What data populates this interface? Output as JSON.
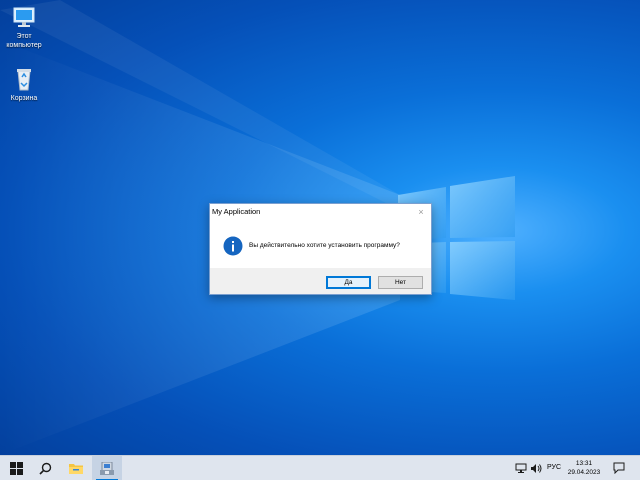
{
  "desktop": {
    "icons": [
      {
        "label": "Этот компьютер",
        "icon": "this-pc-icon"
      },
      {
        "label": "Корзина",
        "icon": "recycle-bin-icon"
      }
    ]
  },
  "dialog": {
    "title": "My Application",
    "close_symbol": "×",
    "message": "Вы действительно хотите установить программу?",
    "icon": "info-icon",
    "yes_label": "Да",
    "no_label": "Нет"
  },
  "taskbar": {
    "language": "РУС",
    "time": "13:31",
    "date": "29.04.2023",
    "items": [
      "start-icon",
      "search-icon",
      "file-explorer-icon",
      "installer-app-icon"
    ]
  },
  "colors": {
    "accent": "#0078d7",
    "info_icon": "#1565c0"
  }
}
